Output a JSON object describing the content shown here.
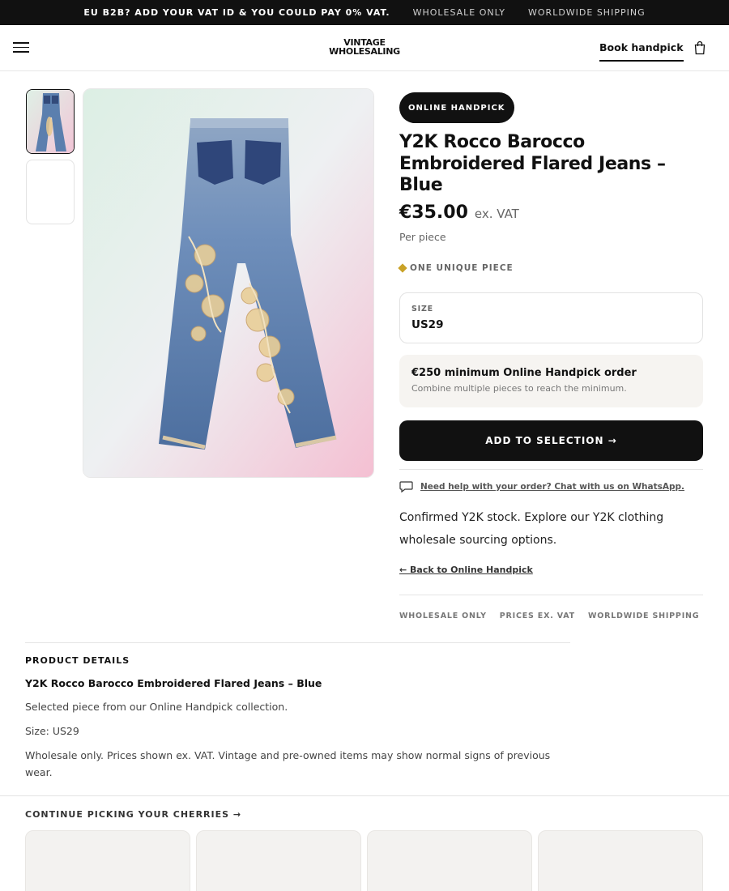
{
  "announcement": {
    "vat_text": "EU B2B? ADD YOUR VAT ID & YOU COULD PAY 0% VAT.",
    "wholesale_text": "WHOLESALE ONLY",
    "shipping_text": "WORLDWIDE SHIPPING"
  },
  "header": {
    "logo_line1": "VINTAGE",
    "logo_line2": "WHOLESALING",
    "book_link": "Book handpick",
    "menu_icon": "hamburger-icon",
    "cart_icon": "shopping-bag-icon"
  },
  "product": {
    "badge": "ONLINE HANDPICK",
    "title": "Y2K Rocco Barocco Embroidered Flared Jeans – Blue",
    "price": "€35.00",
    "vat_note": "ex. VAT",
    "per_piece": "Per piece",
    "unique_label": "ONE UNIQUE PIECE",
    "size_label": "SIZE",
    "size_value": "US29",
    "minimum_title": "€250 minimum Online Handpick order",
    "minimum_sub": "Combine multiple pieces to reach the minimum.",
    "add_button": "ADD TO SELECTION →",
    "help_link": "Need help with your order? Chat with us on WhatsApp.",
    "description": "Confirmed Y2K stock. Explore our Y2K clothing wholesale sourcing options.",
    "back_link": "← Back to Online Handpick",
    "tags": [
      "WHOLESALE ONLY",
      "PRICES EX. VAT",
      "WORLDWIDE SHIPPING"
    ]
  },
  "details": {
    "heading": "PRODUCT DETAILS",
    "title": "Y2K Rocco Barocco Embroidered Flared Jeans – Blue",
    "line1": "Selected piece from our Online Handpick collection.",
    "line2": "Size: US29",
    "line3": "Wholesale only. Prices shown ex. VAT. Vintage and pre-owned items may show normal signs of previous wear."
  },
  "related": {
    "heading": "CONTINUE PICKING YOUR CHERRIES →"
  },
  "colors": {
    "primary": "#111111",
    "accent_diamond": "#c9a227",
    "denim": "#5b7fae"
  }
}
